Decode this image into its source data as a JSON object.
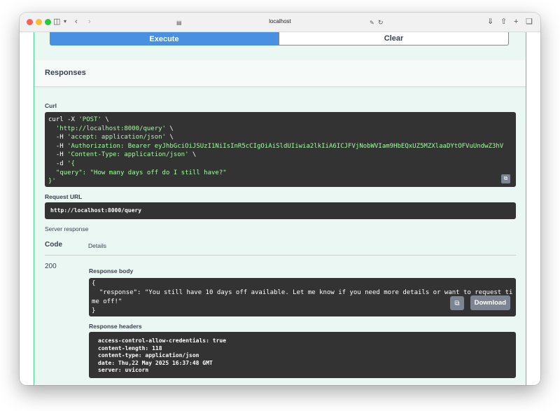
{
  "browser": {
    "address": "localhost"
  },
  "buttons": {
    "execute": "Execute",
    "clear": "Clear"
  },
  "responses": {
    "title": "Responses",
    "curl_label": "Curl",
    "curl_lines": [
      {
        "pre": "curl -X ",
        "str": "'POST'",
        "post": " \\"
      },
      {
        "pre": "  ",
        "str": "'http://localhost:8000/query'",
        "post": " \\"
      },
      {
        "pre": "  -H ",
        "str": "'accept: application/json'",
        "post": " \\"
      },
      {
        "pre": "  -H ",
        "str": "'Authorization: Bearer eyJhbGciOiJSUzI1NiIsInR5cCIgOiAiSldUIiwia2lkIiA6ICJFVjNobWVIam9HbEQxUZ5MZXlaaDYtOFVuUndwZ3hV",
        "post": ""
      },
      {
        "pre": "  -H ",
        "str": "'Content-Type: application/json'",
        "post": " \\"
      },
      {
        "pre": "  -d ",
        "str": "'{",
        "post": ""
      },
      {
        "pre": "  ",
        "str": "\"query\": \"How many days off do I still have?\"",
        "post": ""
      },
      {
        "pre": "",
        "str": "}'",
        "post": ""
      }
    ],
    "request_url_label": "Request URL",
    "request_url": "http://localhost:8000/query",
    "server_response_label": "Server response",
    "col_code": "Code",
    "col_details": "Details",
    "status_code": "200",
    "response_body_label": "Response body",
    "response_body": "{\n  \"response\": \"You still have 10 days off available. Let me know if you need more details or want to request time off!\"\n}",
    "download_label": "Download",
    "response_headers_label": "Response headers",
    "response_headers": [
      "access-control-allow-credentials: true",
      "content-length: 118",
      "content-type: application/json",
      "date: Thu,22 May 2025 16:37:48 GMT",
      "server: uvicorn"
    ]
  }
}
